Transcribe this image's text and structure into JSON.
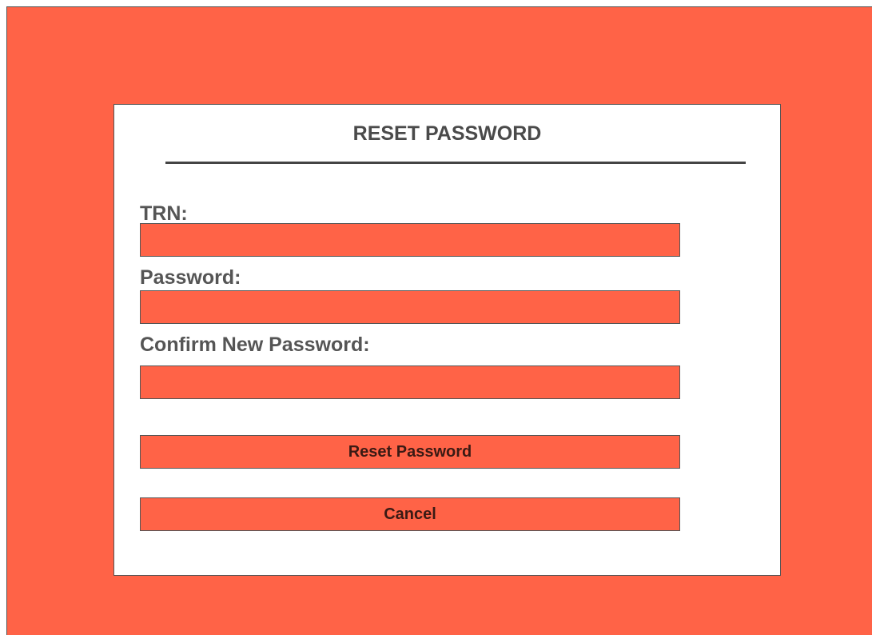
{
  "colors": {
    "background": "#ff6347",
    "dialog": "#ffffff",
    "field_fill": "#ff6347",
    "border": "#555555",
    "text": "#4a4a4a"
  },
  "dialog": {
    "title": "RESET PASSWORD"
  },
  "form": {
    "fields": [
      {
        "label": "TRN:",
        "value": ""
      },
      {
        "label": "Password:",
        "value": ""
      },
      {
        "label": "Confirm New Password:",
        "value": ""
      }
    ]
  },
  "buttons": {
    "reset_label": "Reset Password",
    "cancel_label": "Cancel"
  }
}
